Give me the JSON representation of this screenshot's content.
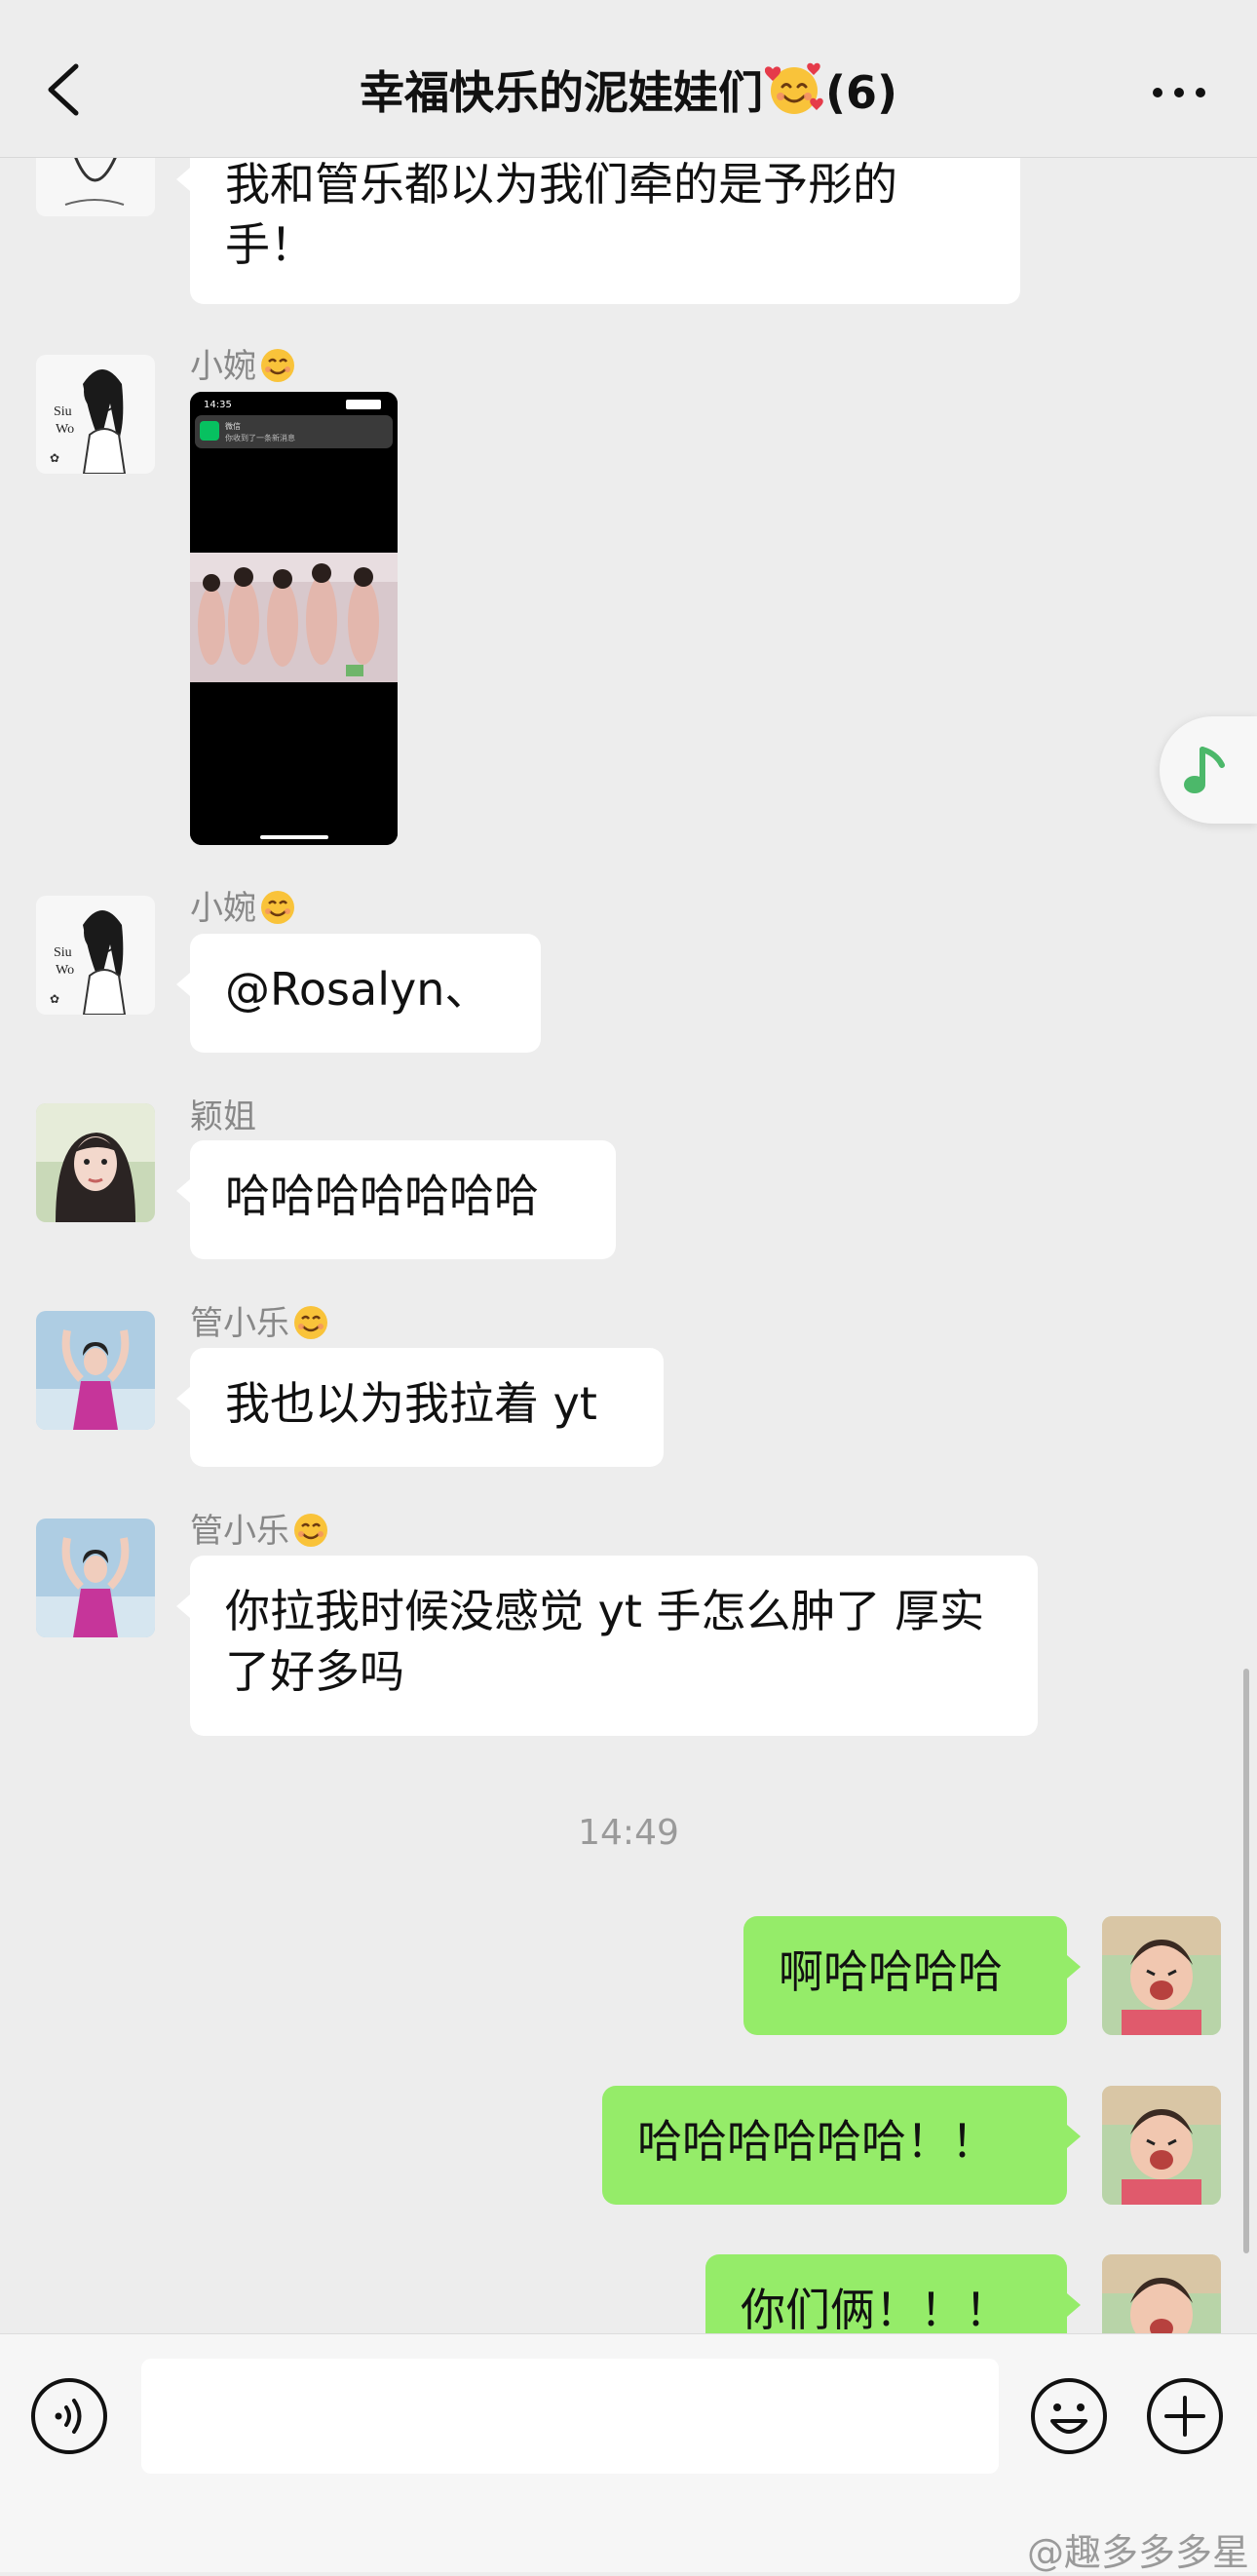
{
  "header": {
    "back_icon": "chevron-left-icon",
    "title": "幸福快乐的泥娃娃们",
    "member_count": "(6)",
    "title_emoji": "smiling-face-with-hearts",
    "more_icon": "more-dots-icon"
  },
  "messages": [
    {
      "direction": "in",
      "sender": "",
      "text": "我和管乐都以为我们牵的是予彤的手！"
    },
    {
      "direction": "in",
      "sender": "小婉",
      "type": "image"
    },
    {
      "direction": "in",
      "sender": "小婉",
      "text": "@Rosalyn、"
    },
    {
      "direction": "in",
      "sender": "颖姐",
      "text": "哈哈哈哈哈哈哈"
    },
    {
      "direction": "in",
      "sender": "管小乐",
      "text": "我也以为我拉着 yt"
    },
    {
      "direction": "in",
      "sender": "管小乐",
      "text": "你拉我时候没感觉 yt 手怎么肿了 厚实了好多吗"
    },
    {
      "direction": "out",
      "text": "啊哈哈哈哈"
    },
    {
      "direction": "out",
      "text": "哈哈哈哈哈哈！！"
    },
    {
      "direction": "out",
      "text": "你们俩！！！"
    }
  ],
  "timestamp": "14:49",
  "image_msg": {
    "status_time": "14:35",
    "notif_app": "微信",
    "notif_text": "你收到了一条新消息"
  },
  "music_float_icon": "music-note-icon",
  "input_bar": {
    "voice_icon": "voice-icon",
    "emoji_icon": "emoji-icon",
    "plus_icon": "plus-icon",
    "input_value": ""
  },
  "watermark": "@趣多多多星",
  "colors": {
    "background": "#ededed",
    "bubble_in": "#ffffff",
    "bubble_out": "#95ec69",
    "sender_text": "#888888",
    "accent_green": "#07c160"
  }
}
